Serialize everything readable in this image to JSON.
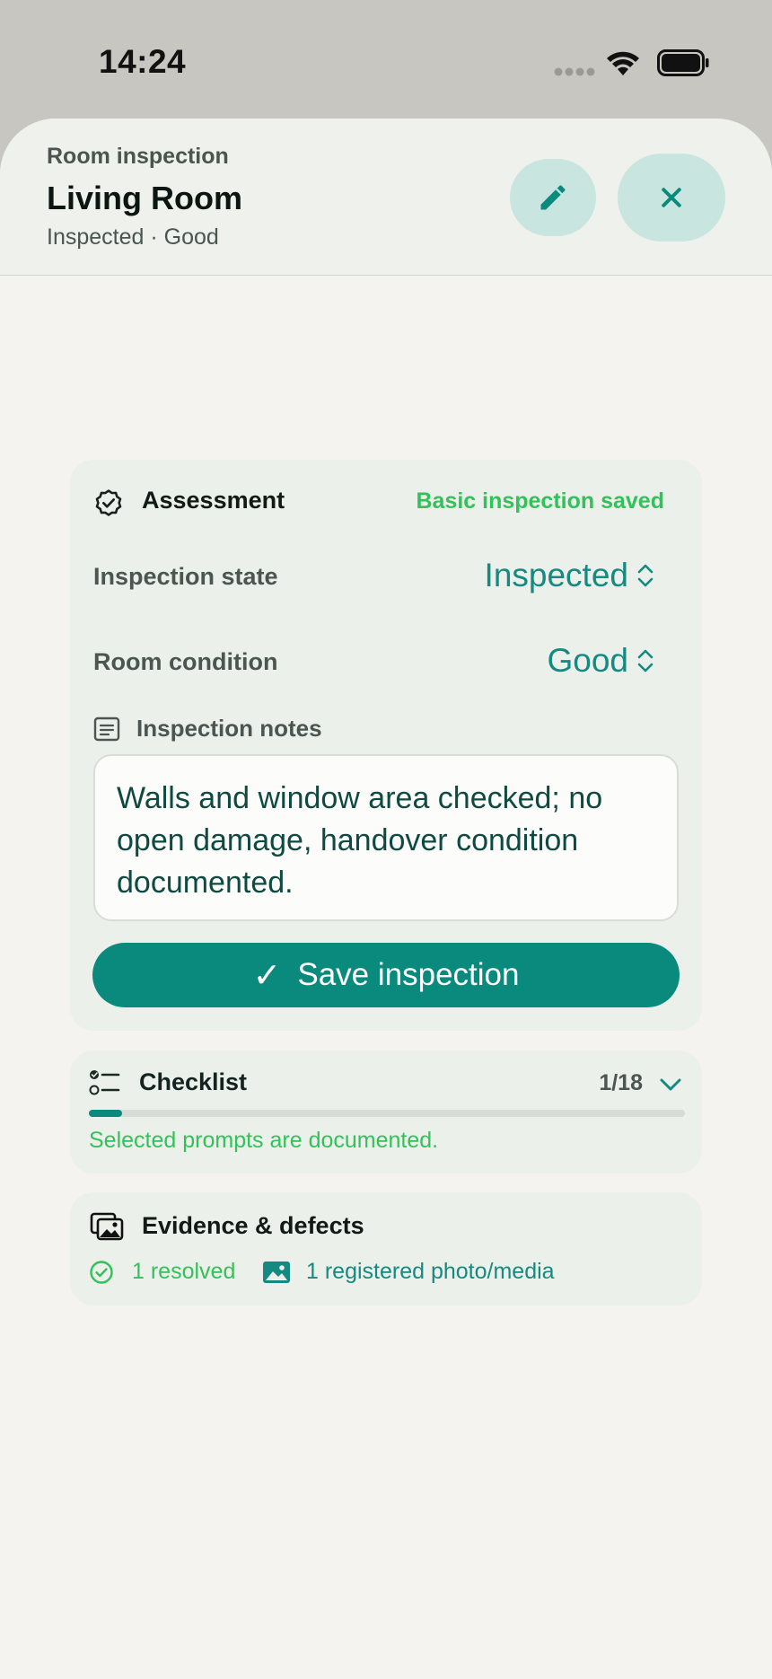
{
  "status_bar": {
    "time": "14:24",
    "icons": [
      "cellular-signal-icon",
      "wifi-icon",
      "battery-icon"
    ]
  },
  "header": {
    "kicker": "Room inspection",
    "title": "Living Room",
    "subtitle": "Inspected · Good",
    "edit_icon": "pencil-icon",
    "close_icon": "close-icon"
  },
  "assessment": {
    "icon": "verified-badge-icon",
    "title": "Assessment",
    "status": "Basic inspection saved",
    "state_label": "Inspection state",
    "state_value": "Inspected",
    "condition_label": "Room condition",
    "condition_value": "Good",
    "notes_label": "Inspection notes",
    "notes_text": "Walls and window area checked; no open damage, handover condition documented.",
    "save_label": "Save inspection"
  },
  "checklist": {
    "icon": "checklist-icon",
    "title": "Checklist",
    "count": "1/18",
    "progress_fraction": 0.0556,
    "note": "Selected prompts are documented."
  },
  "evidence": {
    "icon": "photo-stack-icon",
    "title": "Evidence & defects",
    "resolved_text": "1 resolved",
    "media_text": "1 registered photo/media"
  },
  "colors": {
    "accent": "#0a8a7d",
    "success": "#33c15a",
    "sheet_bg": "#f4f3ef",
    "card_bg": "#ecf0eb"
  }
}
